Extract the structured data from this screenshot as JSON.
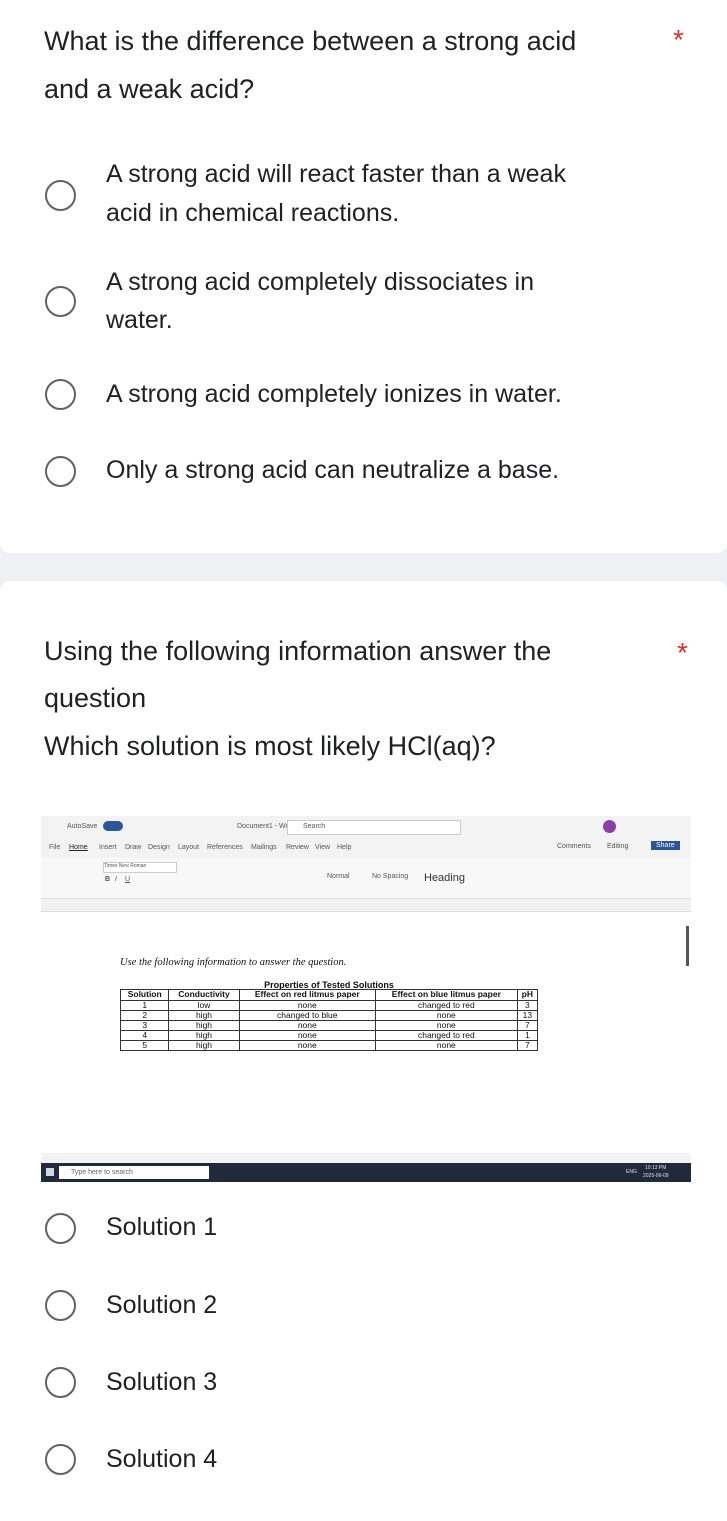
{
  "question1": {
    "title": "What is the difference between a strong acid and a weak acid?",
    "title_line1": "What is the difference between a strong acid",
    "title_line2": "and a weak acid?",
    "required_mark": "*",
    "options": [
      {
        "line1": "A strong acid will react faster than a weak",
        "line2": "acid in chemical reactions."
      },
      {
        "line1": "A strong acid completely dissociates in",
        "line2": "water."
      },
      {
        "line1": "A strong acid completely ionizes in water.",
        "line2": ""
      },
      {
        "line1": "Only a strong acid can neutralize a base.",
        "line2": ""
      }
    ]
  },
  "question2": {
    "title_line1": "Using the following information answer the",
    "title_line2": "question",
    "subtitle": "Which solution is most likely HCl(aq)?",
    "required_mark": "*",
    "options": [
      "Solution 1",
      "Solution 2",
      "Solution 3",
      "Solution 4"
    ]
  },
  "screenshot": {
    "window_title": "Document1 - Word",
    "autosave": "AutoSave",
    "search": "Search",
    "menu": [
      "File",
      "Home",
      "Insert",
      "Draw",
      "Design",
      "Layout",
      "References",
      "Mailings",
      "Review",
      "View",
      "Help"
    ],
    "comments": "Comments",
    "editing": "Editing",
    "share": "Share",
    "font_name": "Times New Roman",
    "style_normal": "Normal",
    "style_nospacing": "No Spacing",
    "style_heading": "Heading",
    "instruction": "Use the following information to answer the question.",
    "table_title": "Properties of Tested Solutions",
    "table_headers": [
      "Solution",
      "Conductivity",
      "Effect on red litmus paper",
      "Effect on blue litmus paper",
      "pH"
    ],
    "table_rows": [
      [
        "1",
        "low",
        "none",
        "changed to red",
        "3"
      ],
      [
        "2",
        "high",
        "changed to blue",
        "none",
        "13"
      ],
      [
        "3",
        "high",
        "none",
        "none",
        "7"
      ],
      [
        "4",
        "high",
        "none",
        "changed to red",
        "1"
      ],
      [
        "5",
        "high",
        "none",
        "none",
        "7"
      ]
    ],
    "taskbar_search": "Type here to search",
    "clock_time": "10:13 PM",
    "clock_date": "2025-06-09",
    "lang": "ENG"
  }
}
